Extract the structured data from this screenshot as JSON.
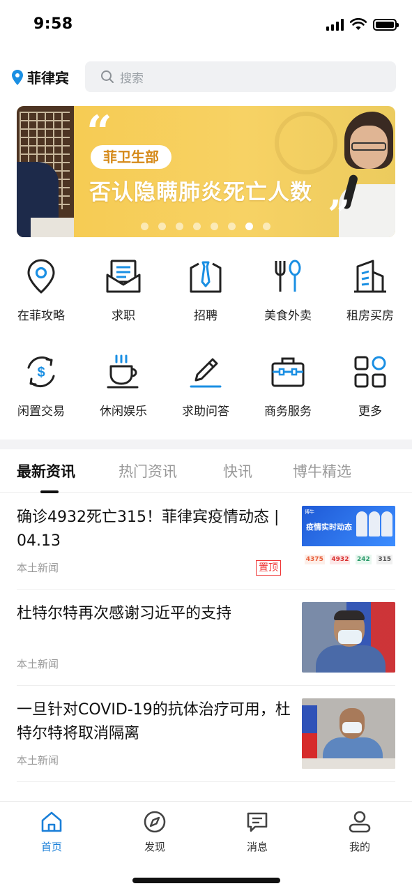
{
  "status_bar": {
    "time": "9:58"
  },
  "header": {
    "location_label": "菲律宾",
    "search_placeholder": "搜索"
  },
  "banner": {
    "tag": "菲卫生部",
    "title": "否认隐瞒肺炎死亡人数",
    "dot_count": 8,
    "active_dot_index": 6
  },
  "categories": [
    {
      "label": "在菲攻略",
      "icon": "location-pin-icon"
    },
    {
      "label": "求职",
      "icon": "envelope-document-icon"
    },
    {
      "label": "招聘",
      "icon": "necktie-icon"
    },
    {
      "label": "美食外卖",
      "icon": "fork-spoon-icon"
    },
    {
      "label": "租房买房",
      "icon": "building-icon"
    },
    {
      "label": "闲置交易",
      "icon": "recycle-dollar-icon"
    },
    {
      "label": "休闲娱乐",
      "icon": "coffee-cup-icon"
    },
    {
      "label": "求助问答",
      "icon": "pencil-icon"
    },
    {
      "label": "商务服务",
      "icon": "briefcase-icon"
    },
    {
      "label": "更多",
      "icon": "grid-more-icon"
    }
  ],
  "tabs": [
    {
      "label": "最新资讯",
      "active": true
    },
    {
      "label": "热门资讯",
      "active": false
    },
    {
      "label": "快讯",
      "active": false
    },
    {
      "label": "博牛精选",
      "active": false
    }
  ],
  "news": [
    {
      "title": "确诊4932死亡315！菲律宾疫情动态 | 04.13",
      "source": "本土新闻",
      "pinned_label": "置顶",
      "thumb": {
        "brand": "博牛",
        "heading": "疫情实时动态",
        "stats": [
          "4375",
          "4932",
          "242",
          "315"
        ]
      }
    },
    {
      "title": "杜特尔特再次感谢习近平的支持",
      "source": "本土新闻"
    },
    {
      "title": "一旦针对COVID-19的抗体治疗可用，杜特尔特将取消隔离",
      "source": "本土新闻"
    }
  ],
  "bottom_nav": [
    {
      "label": "首页",
      "icon": "home-icon",
      "active": true
    },
    {
      "label": "发现",
      "icon": "compass-icon",
      "active": false
    },
    {
      "label": "消息",
      "icon": "message-icon",
      "active": false
    },
    {
      "label": "我的",
      "icon": "profile-icon",
      "active": false
    }
  ],
  "colors": {
    "accent": "#1a7fd8",
    "icon_blue": "#1a8fe3",
    "pin_red": "#e33333",
    "banner_yellow": "#f6c94e"
  }
}
